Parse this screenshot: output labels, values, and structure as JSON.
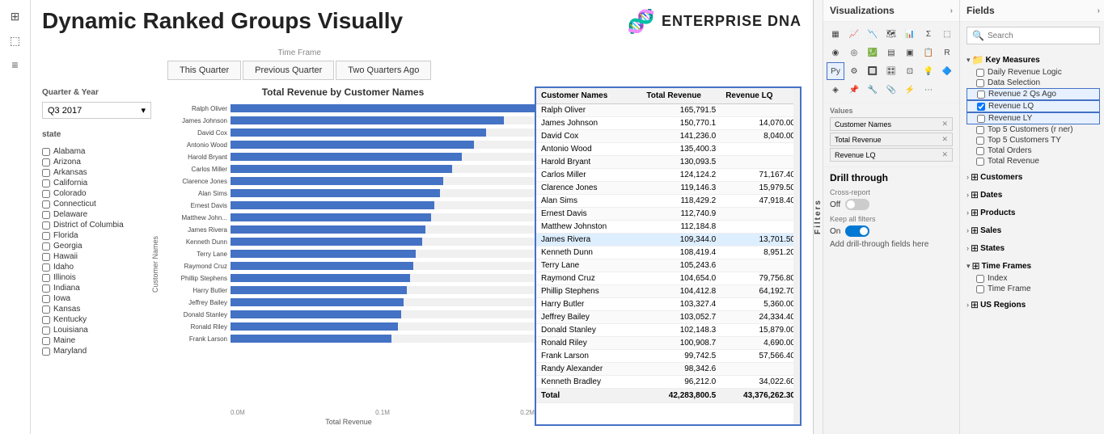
{
  "app": {
    "title": "Dynamic Ranked Groups Visually",
    "logo_text": "ENTERPRISE DNA"
  },
  "header": {
    "time_frame_label": "Time Frame",
    "buttons": [
      "This Quarter",
      "Previous Quarter",
      "Two Quarters Ago"
    ]
  },
  "quarter_filter": {
    "label": "Quarter & Year",
    "value": "Q3 2017"
  },
  "state_filter": {
    "label": "state",
    "states": [
      "Alabama",
      "Arizona",
      "Arkansas",
      "California",
      "Colorado",
      "Connecticut",
      "Delaware",
      "District of Columbia",
      "Florida",
      "Georgia",
      "Hawaii",
      "Idaho",
      "Illinois",
      "Indiana",
      "Iowa",
      "Kansas",
      "Kentucky",
      "Louisiana",
      "Maine",
      "Maryland"
    ]
  },
  "chart": {
    "title": "Total Revenue by Customer Names",
    "y_axis_label": "Customer Names",
    "x_axis_label": "Total Revenue",
    "x_axis_ticks": [
      "0.0M",
      "0.1M",
      "0.2M"
    ],
    "bars": [
      {
        "name": "Ralph Oliver",
        "pct": 100
      },
      {
        "name": "James Johnson",
        "pct": 90
      },
      {
        "name": "David Cox",
        "pct": 84
      },
      {
        "name": "Antonio Wood",
        "pct": 80
      },
      {
        "name": "Harold Bryant",
        "pct": 76
      },
      {
        "name": "Carlos Miller",
        "pct": 73
      },
      {
        "name": "Clarence Jones",
        "pct": 70
      },
      {
        "name": "Alan Sims",
        "pct": 69
      },
      {
        "name": "Ernest Davis",
        "pct": 67
      },
      {
        "name": "Matthew John...",
        "pct": 66
      },
      {
        "name": "James Rivera",
        "pct": 64
      },
      {
        "name": "Kenneth Dunn",
        "pct": 63
      },
      {
        "name": "Terry Lane",
        "pct": 61
      },
      {
        "name": "Raymond Cruz",
        "pct": 60
      },
      {
        "name": "Phillip Stephens",
        "pct": 59
      },
      {
        "name": "Harry Butler",
        "pct": 58
      },
      {
        "name": "Jeffrey Bailey",
        "pct": 57
      },
      {
        "name": "Donald Stanley",
        "pct": 56
      },
      {
        "name": "Ronald Riley",
        "pct": 55
      },
      {
        "name": "Frank Larson",
        "pct": 53
      }
    ]
  },
  "table": {
    "headers": [
      "Customer Names",
      "Total Revenue",
      "Revenue LQ"
    ],
    "rows": [
      {
        "name": "Ralph Oliver",
        "revenue": "165,791.5",
        "lq": "",
        "highlight": false
      },
      {
        "name": "James Johnson",
        "revenue": "150,770.1",
        "lq": "14,070.00",
        "highlight": false
      },
      {
        "name": "David Cox",
        "revenue": "141,236.0",
        "lq": "8,040.00",
        "highlight": false
      },
      {
        "name": "Antonio Wood",
        "revenue": "135,400.3",
        "lq": "",
        "highlight": false
      },
      {
        "name": "Harold Bryant",
        "revenue": "130,093.5",
        "lq": "",
        "highlight": false
      },
      {
        "name": "Carlos Miller",
        "revenue": "124,124.2",
        "lq": "71,167.40",
        "highlight": false
      },
      {
        "name": "Clarence Jones",
        "revenue": "119,146.3",
        "lq": "15,979.50",
        "highlight": false
      },
      {
        "name": "Alan Sims",
        "revenue": "118,429.2",
        "lq": "47,918.40",
        "highlight": false
      },
      {
        "name": "Ernest Davis",
        "revenue": "112,740.9",
        "lq": "",
        "highlight": false
      },
      {
        "name": "Matthew Johnston",
        "revenue": "112,184.8",
        "lq": "",
        "highlight": false
      },
      {
        "name": "James Rivera",
        "revenue": "109,344.0",
        "lq": "13,701.50",
        "highlight": true
      },
      {
        "name": "Kenneth Dunn",
        "revenue": "108,419.4",
        "lq": "8,951.20",
        "highlight": false
      },
      {
        "name": "Terry Lane",
        "revenue": "105,243.6",
        "lq": "",
        "highlight": false
      },
      {
        "name": "Raymond Cruz",
        "revenue": "104,654.0",
        "lq": "79,756.80",
        "highlight": false
      },
      {
        "name": "Phillip Stephens",
        "revenue": "104,412.8",
        "lq": "64,192.70",
        "highlight": false
      },
      {
        "name": "Harry Butler",
        "revenue": "103,327.4",
        "lq": "5,360.00",
        "highlight": false
      },
      {
        "name": "Jeffrey Bailey",
        "revenue": "103,052.7",
        "lq": "24,334.40",
        "highlight": false
      },
      {
        "name": "Donald Stanley",
        "revenue": "102,148.3",
        "lq": "15,879.00",
        "highlight": false
      },
      {
        "name": "Ronald Riley",
        "revenue": "100,908.7",
        "lq": "4,690.00",
        "highlight": false
      },
      {
        "name": "Frank Larson",
        "revenue": "99,742.5",
        "lq": "57,566.40",
        "highlight": false
      },
      {
        "name": "Randy Alexander",
        "revenue": "98,342.6",
        "lq": "",
        "highlight": false
      },
      {
        "name": "Kenneth Bradley",
        "revenue": "96,212.0",
        "lq": "34,022.60",
        "highlight": false
      }
    ],
    "footer": {
      "label": "Total",
      "revenue": "42,283,800.5",
      "lq": "43,376,262.30"
    }
  },
  "visualizations": {
    "title": "Visualizations",
    "icons": [
      "📊",
      "📈",
      "📉",
      "📋",
      "🗺",
      "🎯",
      "⬛",
      "🔵",
      "📐",
      "💹",
      "🗃",
      "⭕",
      "🔶",
      "▦",
      "🔷",
      "📌",
      "🔲",
      "🎛",
      "🧩",
      "🔍",
      "⚙",
      "💻",
      "🎨",
      "📎",
      "🔧",
      "📏",
      "🗑"
    ],
    "values_label": "Values",
    "value_chips": [
      {
        "label": "Customer Names",
        "has_x": true
      },
      {
        "label": "Total Revenue",
        "has_x": true
      },
      {
        "label": "Revenue LQ",
        "has_x": true
      }
    ],
    "drill_through": {
      "title": "Drill through",
      "cross_report_label": "Cross-report",
      "off_label": "Off",
      "keep_filters_label": "Keep all filters",
      "on_label": "On",
      "add_btn": "Add drill-through fields here"
    }
  },
  "fields": {
    "title": "Fields",
    "search_placeholder": "Search",
    "groups": [
      {
        "name": "Key Measures",
        "icon": "folder",
        "expanded": true,
        "items": [
          {
            "label": "Daily Revenue Logic",
            "checked": false,
            "highlighted": false
          },
          {
            "label": "Data Selection",
            "checked": false,
            "highlighted": false
          },
          {
            "label": "Revenue 2 Qs Ago",
            "checked": false,
            "highlighted": true
          },
          {
            "label": "Revenue LQ",
            "checked": true,
            "highlighted": true
          },
          {
            "label": "Revenue LY",
            "checked": false,
            "highlighted": true
          },
          {
            "label": "Top 5 Customers (r ner)",
            "checked": false,
            "highlighted": false
          },
          {
            "label": "Top 5 Customers TY",
            "checked": false,
            "highlighted": false
          },
          {
            "label": "Total Orders",
            "checked": false,
            "highlighted": false
          },
          {
            "label": "Total Revenue",
            "checked": false,
            "highlighted": false
          }
        ]
      },
      {
        "name": "Customers",
        "icon": "table",
        "expanded": false,
        "items": []
      },
      {
        "name": "Dates",
        "icon": "table",
        "expanded": false,
        "items": []
      },
      {
        "name": "Products",
        "icon": "table",
        "expanded": false,
        "items": []
      },
      {
        "name": "Sales",
        "icon": "table",
        "expanded": false,
        "items": []
      },
      {
        "name": "States",
        "icon": "table",
        "expanded": false,
        "items": []
      },
      {
        "name": "Time Frames",
        "icon": "table",
        "expanded": true,
        "items": [
          {
            "label": "Index",
            "checked": false,
            "highlighted": false
          },
          {
            "label": "Time Frame",
            "checked": false,
            "highlighted": false
          }
        ]
      },
      {
        "name": "US Regions",
        "icon": "table",
        "expanded": false,
        "items": []
      }
    ]
  }
}
